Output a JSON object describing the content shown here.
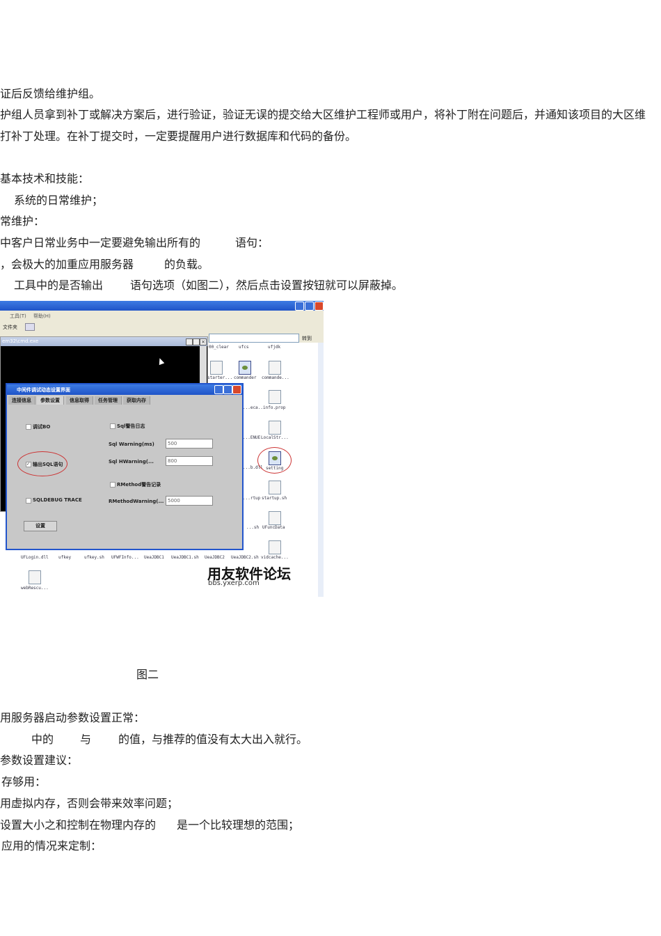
{
  "doc": {
    "lines_top": [
      "证后反馈给维护组。",
      "护组人员拿到补丁或解决方案后，进行验证，验证无误的提交给大区维护工程师或用户，将补丁附在问题后，并通知该项目的大区维",
      "打补丁处理。在补丁提交时，一定要提醒用户进行数据库和代码的备份。",
      "基本技术和技能：",
      "系统的日常维护；",
      "常维护："
    ],
    "line7": [
      "中客户日常业务中一定要避免输出所有的",
      "语句："
    ],
    "line8": [
      "，会极大的加重应用服务器",
      "的负载。"
    ],
    "line9": [
      "工具中的是否输出",
      "语句选项（如图二），然后点击设置按钮就可以屏蔽掉。"
    ],
    "caption": "图二",
    "lines_bottom": [
      "用服务器启动参数设置正常：",
      "参数设置建议：",
      "存够用：",
      "用虚拟内存，否则会带来效率问题；",
      "应用的情况来定制："
    ],
    "line_b2": [
      "中的",
      "与",
      "的值，与推荐的值没有太大出入就行。"
    ],
    "line_b6": [
      "设置大小之和控制在物理内存的",
      "是一个比较理想的范围；"
    ]
  },
  "screenshot": {
    "menu": [
      "工具(T)",
      "帮助(H)"
    ],
    "toolbar_folders": "文件夹",
    "go_button": "转到",
    "cmd_title": "em32\\cmd.exe",
    "dialog_title": "中间件调试动态设置界面",
    "tabs": [
      "连接信息",
      "参数设置",
      "信息取得",
      "任务管理",
      "获取内存"
    ],
    "options": {
      "debug_bo": "调试BO",
      "output_sql": "输出SQL语句",
      "sqldebug_trace": "SQLDEBUG TRACE",
      "sql_warn_log": "Sql警告日志",
      "rmethod_warn_log": "RMethod警告记录"
    },
    "fields": [
      {
        "label": "Sql Warning(ms)",
        "value": "500"
      },
      {
        "label": "Sql HWarning(...",
        "value": "800"
      },
      {
        "label": "RMethodWarning(...",
        "value": "5000"
      }
    ],
    "set_button": "设置",
    "files": [
      "00_clear",
      "ufcs",
      "ufjdk",
      "starter...",
      "commander",
      "commande...",
      "...eca...",
      "info.prop",
      "...ENUE",
      "LocalStr...",
      "...b.dll",
      "setting",
      "...rtup",
      "startup.sh",
      "...sh",
      "UFuncData",
      "UFLogin.dll",
      "ufkey",
      "ufkey.sh",
      "UFWFInfo...",
      "UeaJDBC1",
      "UeaJDBC1.sh",
      "UeaJDBC2",
      "UeaJDBC2.sh",
      "vidcache...",
      "webRescu..."
    ],
    "watermark_title": "用友软件论坛",
    "watermark_url": "bbs.yxerp.com"
  }
}
